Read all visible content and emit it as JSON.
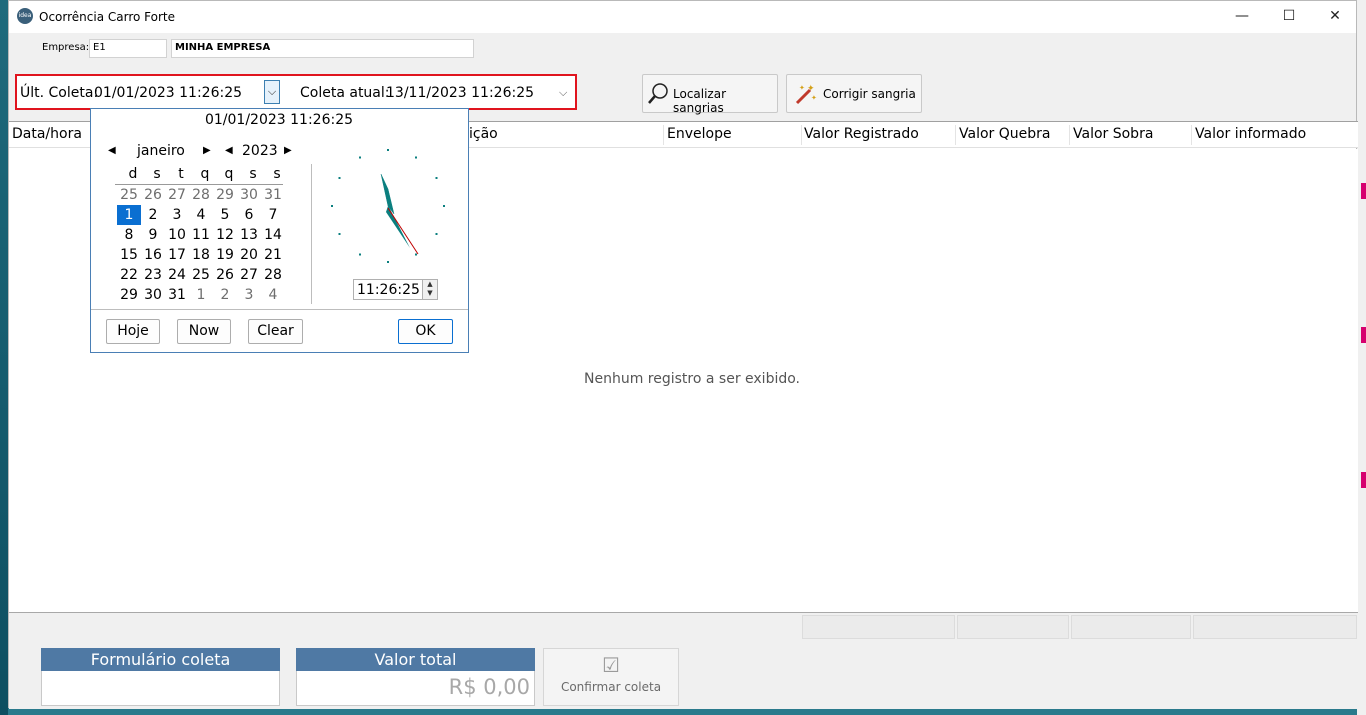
{
  "window": {
    "title": "Ocorrência Carro Forte",
    "app_icon_text": "idea",
    "minimize": "—",
    "maximize": "☐",
    "close": "✕"
  },
  "form": {
    "empresa_label": "Empresa:",
    "empresa_code": "E1",
    "empresa_name": "MINHA EMPRESA",
    "ult_coleta_label": "Últ. Coleta:",
    "ult_coleta_value": "01/01/2023 11:26:25",
    "coleta_atual_label": "Coleta atual:",
    "coleta_atual_value": "13/11/2023 11:26:25"
  },
  "toolbar": {
    "localizar_label": "Localizar sangrias",
    "corrigir_label": "Corrigir sangria"
  },
  "grid": {
    "columns": [
      "Data/hora",
      "ição",
      "Envelope",
      "Valor Registrado",
      "Valor Quebra",
      "Valor Sobra",
      "Valor informado"
    ],
    "empty_message": "Nenhum registro a ser exibido."
  },
  "bottom": {
    "formulario_label": "Formulário coleta",
    "formulario_value": "",
    "valor_total_label": "Valor total",
    "valor_total_value": "R$ 0,00",
    "confirmar_label": "Confirmar coleta"
  },
  "calendar": {
    "header": "01/01/2023 11:26:25",
    "month": "janeiro",
    "year": "2023",
    "weekdays": [
      "d",
      "s",
      "t",
      "q",
      "q",
      "s",
      "s"
    ],
    "weeks": [
      [
        "25",
        "26",
        "27",
        "28",
        "29",
        "30",
        "31"
      ],
      [
        "1",
        "2",
        "3",
        "4",
        "5",
        "6",
        "7"
      ],
      [
        "8",
        "9",
        "10",
        "11",
        "12",
        "13",
        "14"
      ],
      [
        "15",
        "16",
        "17",
        "18",
        "19",
        "20",
        "21"
      ],
      [
        "22",
        "23",
        "24",
        "25",
        "26",
        "27",
        "28"
      ],
      [
        "29",
        "30",
        "31",
        "1",
        "2",
        "3",
        "4"
      ]
    ],
    "selected_day": "1",
    "time": "11:26:25",
    "buttons": {
      "hoje": "Hoje",
      "now": "Now",
      "clear": "Clear",
      "ok": "OK"
    },
    "accent": "#0a6fd1",
    "clock_hand_color": "#0b7f7f"
  }
}
